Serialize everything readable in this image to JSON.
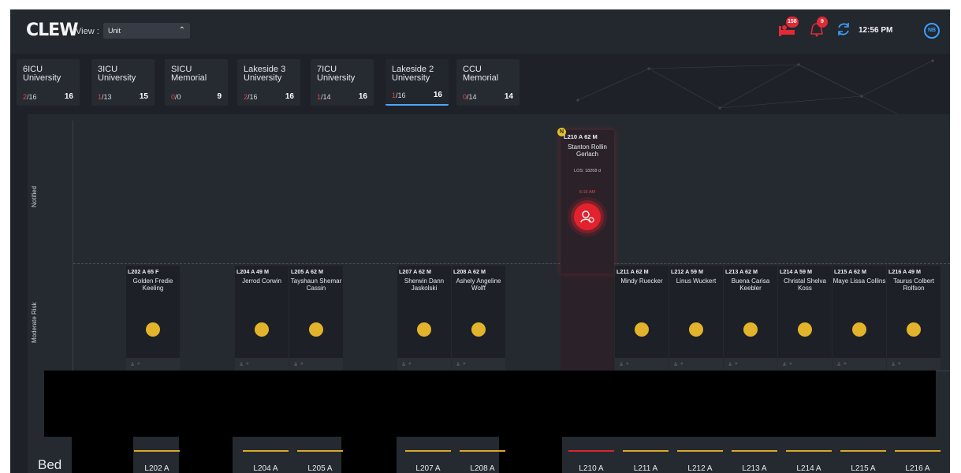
{
  "header": {
    "logo": "CLEW",
    "view_label": "View :",
    "view_value": "Unit",
    "alerts_badge": "158",
    "bell_badge": "9",
    "time": "12:56 PM",
    "user_initials": "NB",
    "colors": {
      "accent": "#3aa0ff",
      "alert": "#e02b36"
    }
  },
  "units": [
    {
      "name1": "6ICU",
      "name2": "University",
      "frac_red": "2",
      "frac_rest": "/16",
      "total": "16"
    },
    {
      "name1": "3ICU",
      "name2": "University",
      "frac_red": "1",
      "frac_rest": "/13",
      "total": "15"
    },
    {
      "name1": "SICU",
      "name2": "Memorial",
      "frac_red": "0",
      "frac_rest": "/0",
      "total": "9"
    },
    {
      "name1": "Lakeside 3",
      "name2": "University",
      "frac_red": "2",
      "frac_rest": "/16",
      "total": "16"
    },
    {
      "name1": "7ICU",
      "name2": "University",
      "frac_red": "1",
      "frac_rest": "/14",
      "total": "16"
    },
    {
      "name1": "Lakeside 2",
      "name2": "University",
      "frac_red": "1",
      "frac_rest": "/16",
      "total": "16"
    },
    {
      "name1": "CCU",
      "name2": "Memorial",
      "frac_red": "0",
      "frac_rest": "/14",
      "total": "14"
    }
  ],
  "rows": {
    "notified": "Notified",
    "moderate": "Moderate Risk",
    "bed": "Bed"
  },
  "notified_patient": {
    "badge": "N",
    "header": "L210 A   62 M",
    "name": "Stanton Rollin Gerlach",
    "los": "LOS: 18268 d",
    "time": "6:15 AM",
    "color": "#e3222e"
  },
  "patients": [
    {
      "header": "L202 A   65 F",
      "name": "Golden Fredie Keeling"
    },
    {
      "header": "L204 A   49 M",
      "name": "Jerrod Corwin"
    },
    {
      "header": "L205 A   62 M",
      "name": "Tayshaun Shemar Cassin"
    },
    {
      "header": "L207 A   62 M",
      "name": "Sherwin Dann Jaskolski"
    },
    {
      "header": "L208 A   62 M",
      "name": "Ashely Angeline Wolff"
    },
    {
      "header": "L211 A   62 M",
      "name": "Mindy Ruecker"
    },
    {
      "header": "L212 A   59 M",
      "name": "Linus Wuckert"
    },
    {
      "header": "L213 A   62 M",
      "name": "Buena Carisa Keebler"
    },
    {
      "header": "L214 A   59 M",
      "name": "Christal Shelva Koss"
    },
    {
      "header": "L215 A   62 M",
      "name": "Maye Lissa Collins"
    },
    {
      "header": "L216 A   49 M",
      "name": "Taurus Colbert Rolfson"
    }
  ],
  "beds": [
    "L202 A",
    "L204 A",
    "L205 A",
    "L207 A",
    "L208 A",
    "L210 A",
    "L211 A",
    "L212 A",
    "L213 A",
    "L214 A",
    "L215 A",
    "L216 A"
  ],
  "risk_color": "#e3b32c"
}
